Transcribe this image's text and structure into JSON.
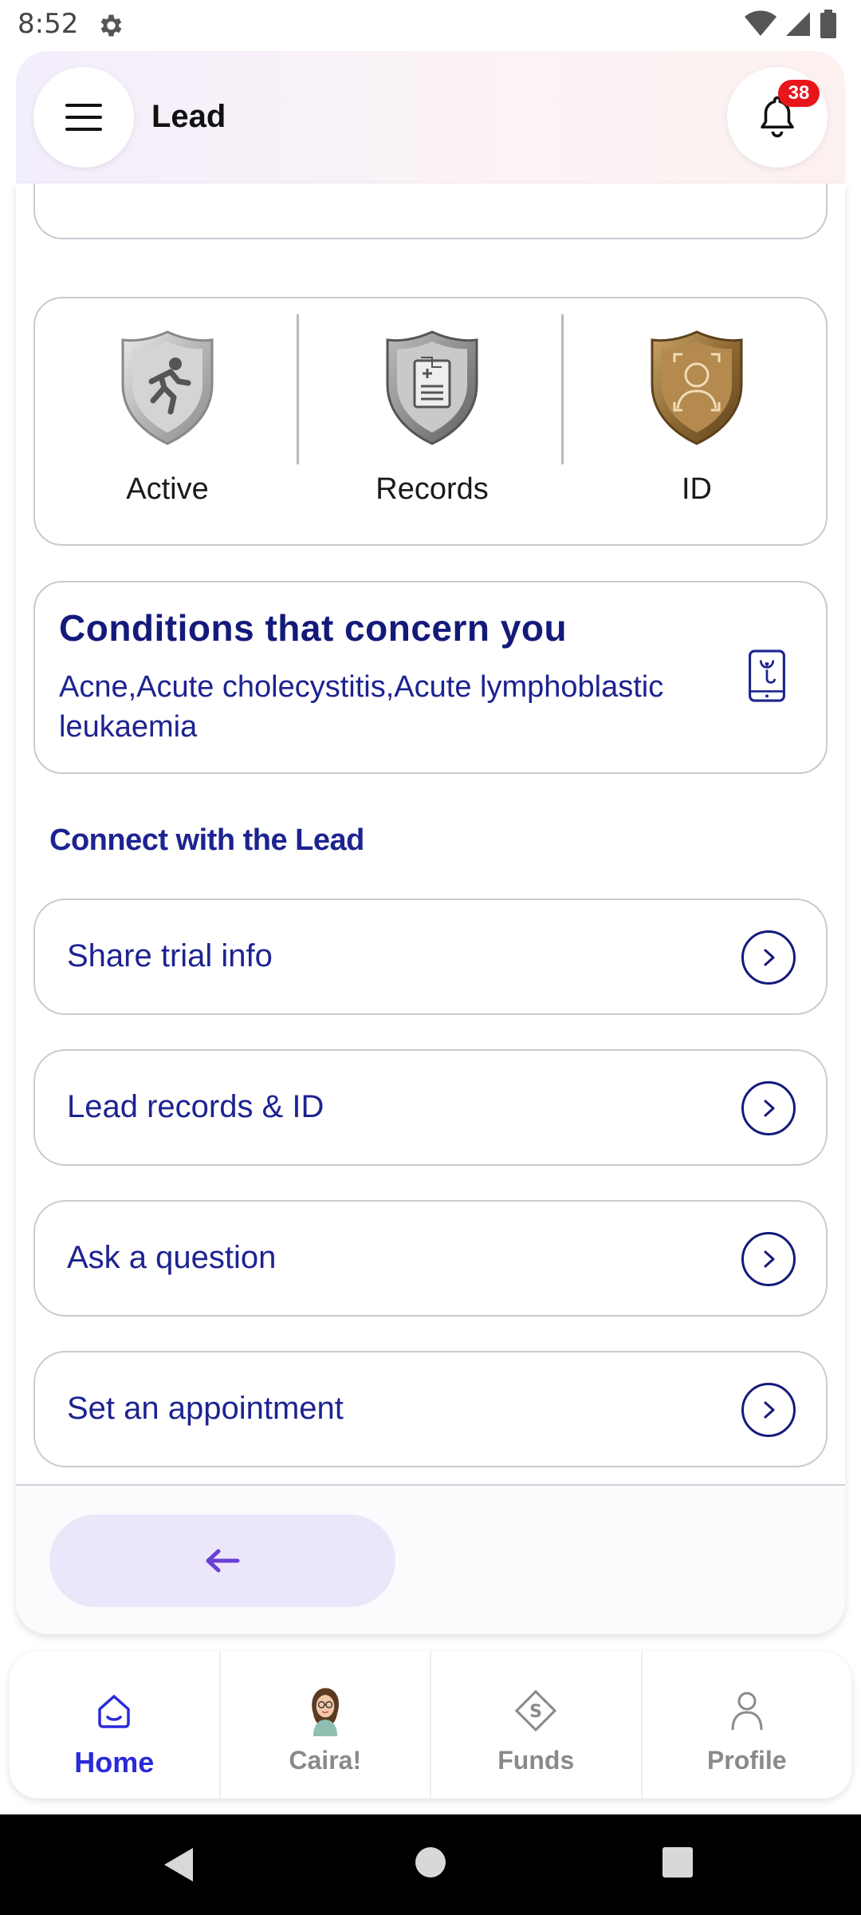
{
  "status_bar": {
    "time": "8:52"
  },
  "app_bar": {
    "title": "Lead",
    "notification_count": "38"
  },
  "badges": [
    {
      "label": "Active",
      "icon": "running-shield-icon",
      "color": "#c0c0c0"
    },
    {
      "label": "Records",
      "icon": "records-shield-icon",
      "color": "#9a9a9a"
    },
    {
      "label": "ID",
      "icon": "id-shield-icon",
      "color": "#8a6530"
    }
  ],
  "conditions": {
    "title": "Conditions that concern you",
    "text": "Acne,Acute cholecystitis,Acute lymphoblastic leukaemia"
  },
  "connect": {
    "title": "Connect with the Lead",
    "actions": [
      {
        "label": "Share trial info"
      },
      {
        "label": "Lead records & ID"
      },
      {
        "label": "Ask a question"
      },
      {
        "label": "Set an appointment"
      }
    ]
  },
  "bottom_nav": {
    "items": [
      {
        "label": "Home",
        "active": true
      },
      {
        "label": "Caira!",
        "active": false
      },
      {
        "label": "Funds",
        "active": false
      },
      {
        "label": "Profile",
        "active": false
      }
    ]
  },
  "colors": {
    "primary_text": "#1d2390",
    "active_nav": "#2a2ad8",
    "badge_red": "#e8151b",
    "back_button_bg": "#ece6fa"
  }
}
